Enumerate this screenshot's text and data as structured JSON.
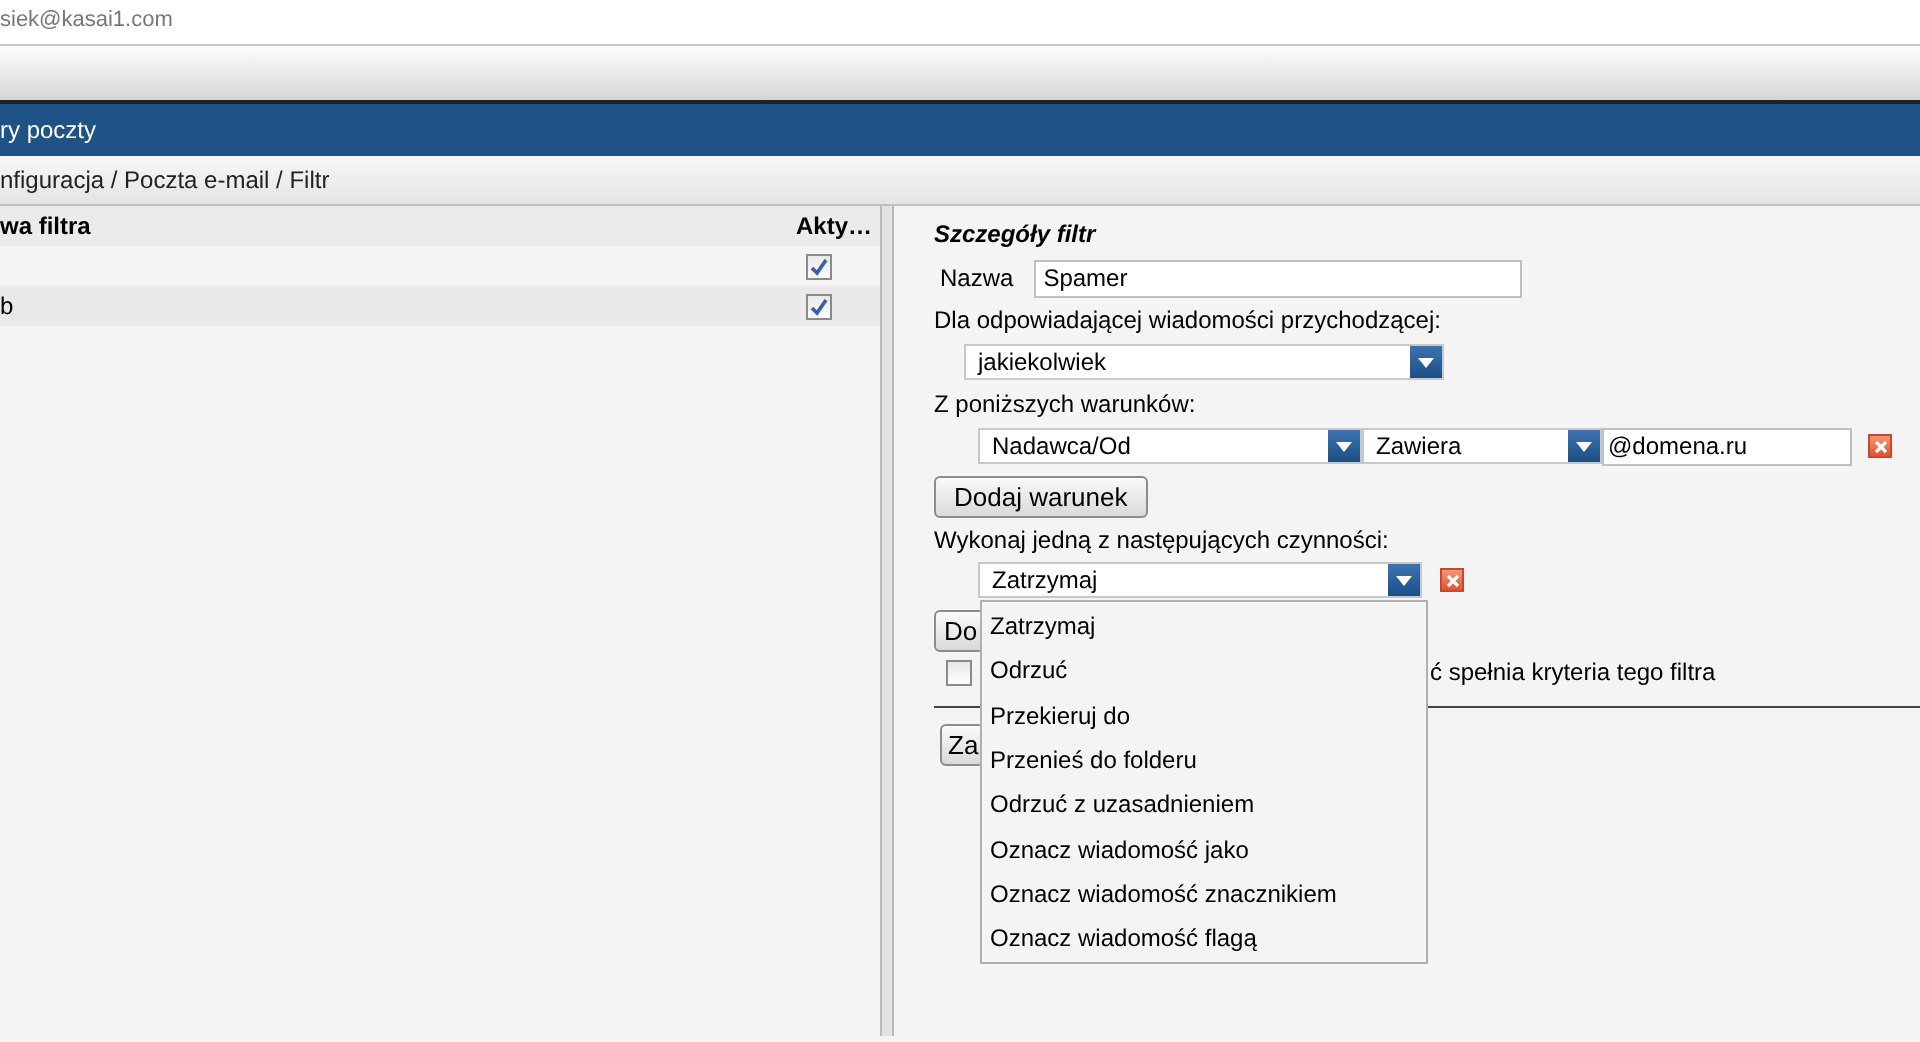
{
  "account": {
    "email": "siek@kasai1.com"
  },
  "title_bar": {
    "title": "ry poczty"
  },
  "breadcrumb": "nfiguracja / Poczta e-mail / Filtr",
  "filter_list": {
    "columns": [
      "wa filtra",
      "Akty…"
    ],
    "rows": [
      {
        "active": true
      },
      {
        "name": "b",
        "active": true
      }
    ]
  },
  "details": {
    "title": "Szczegóły filtr",
    "name_label": "Nazwa",
    "name_value": "Spamer",
    "match_label": "Dla odpowiadającej wiadomości przychodzącej:",
    "match_select": "jakiekolwiek",
    "conditions_label": "Z poniższych warunków:",
    "conditions": [
      {
        "field": "Nadawca/Od",
        "operator": "Zawiera",
        "value": "@domena.ru"
      }
    ],
    "add_condition_button": "Dodaj warunek",
    "actions_label": "Wykonaj jedną z następujących czynności:",
    "actions": [
      {
        "value": "Zatrzymaj"
      }
    ],
    "action_menu": [
      "Zatrzymaj",
      "Odrzuć",
      "Przekieruj do",
      "Przenieś do folderu",
      "Odrzuć z uzasadnieniem",
      "Oznacz wiadomość jako",
      "Oznacz wiadomość znacznikiem",
      "Oznacz wiadomość flagą"
    ],
    "add_action_button": "Do",
    "stop_checkbox": {
      "checked": false,
      "label": "ć spełnia kryteria tego filtra"
    },
    "save_button": "Za"
  }
}
